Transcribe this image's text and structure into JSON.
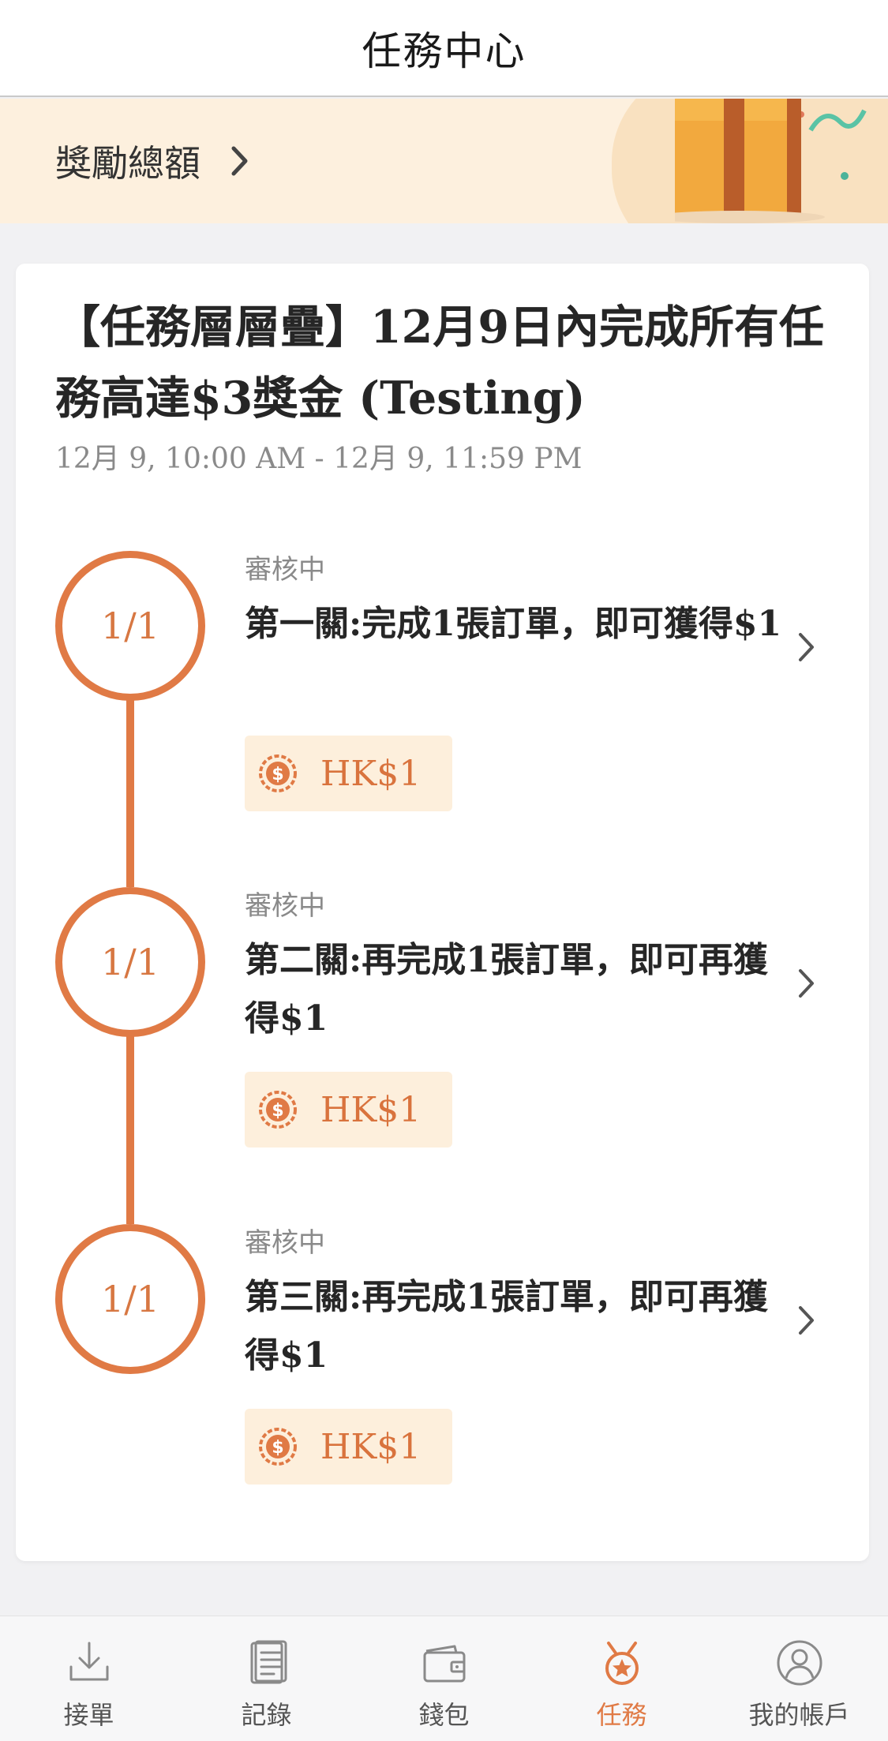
{
  "header": {
    "title": "任務中心"
  },
  "banner": {
    "label": "獎勵總額"
  },
  "card": {
    "heading": "【任務層層疊】12月9日內完成所有任務高達$3獎金 (Testing)",
    "date_range": "12月 9, 10:00 AM - 12月 9, 11:59 PM",
    "tasks": [
      {
        "progress": "1/1",
        "status": "審核中",
        "name": "第一關:完成1張訂單，即可獲得$1",
        "reward": "HK$1"
      },
      {
        "progress": "1/1",
        "status": "審核中",
        "name": "第二關:再完成1張訂單，即可再獲得$1",
        "reward": "HK$1"
      },
      {
        "progress": "1/1",
        "status": "審核中",
        "name": "第三關:再完成1張訂單，即可再獲得$1",
        "reward": "HK$1"
      }
    ]
  },
  "nav": {
    "items": [
      {
        "label": "接單",
        "icon": "download-icon"
      },
      {
        "label": "記錄",
        "icon": "records-icon"
      },
      {
        "label": "錢包",
        "icon": "wallet-icon"
      },
      {
        "label": "任務",
        "icon": "medal-icon",
        "active": true
      },
      {
        "label": "我的帳戶",
        "icon": "account-icon"
      }
    ]
  },
  "colors": {
    "accent": "#e07a45",
    "banner_bg": "#fdf0de",
    "reward_bg": "#fdefdc"
  }
}
